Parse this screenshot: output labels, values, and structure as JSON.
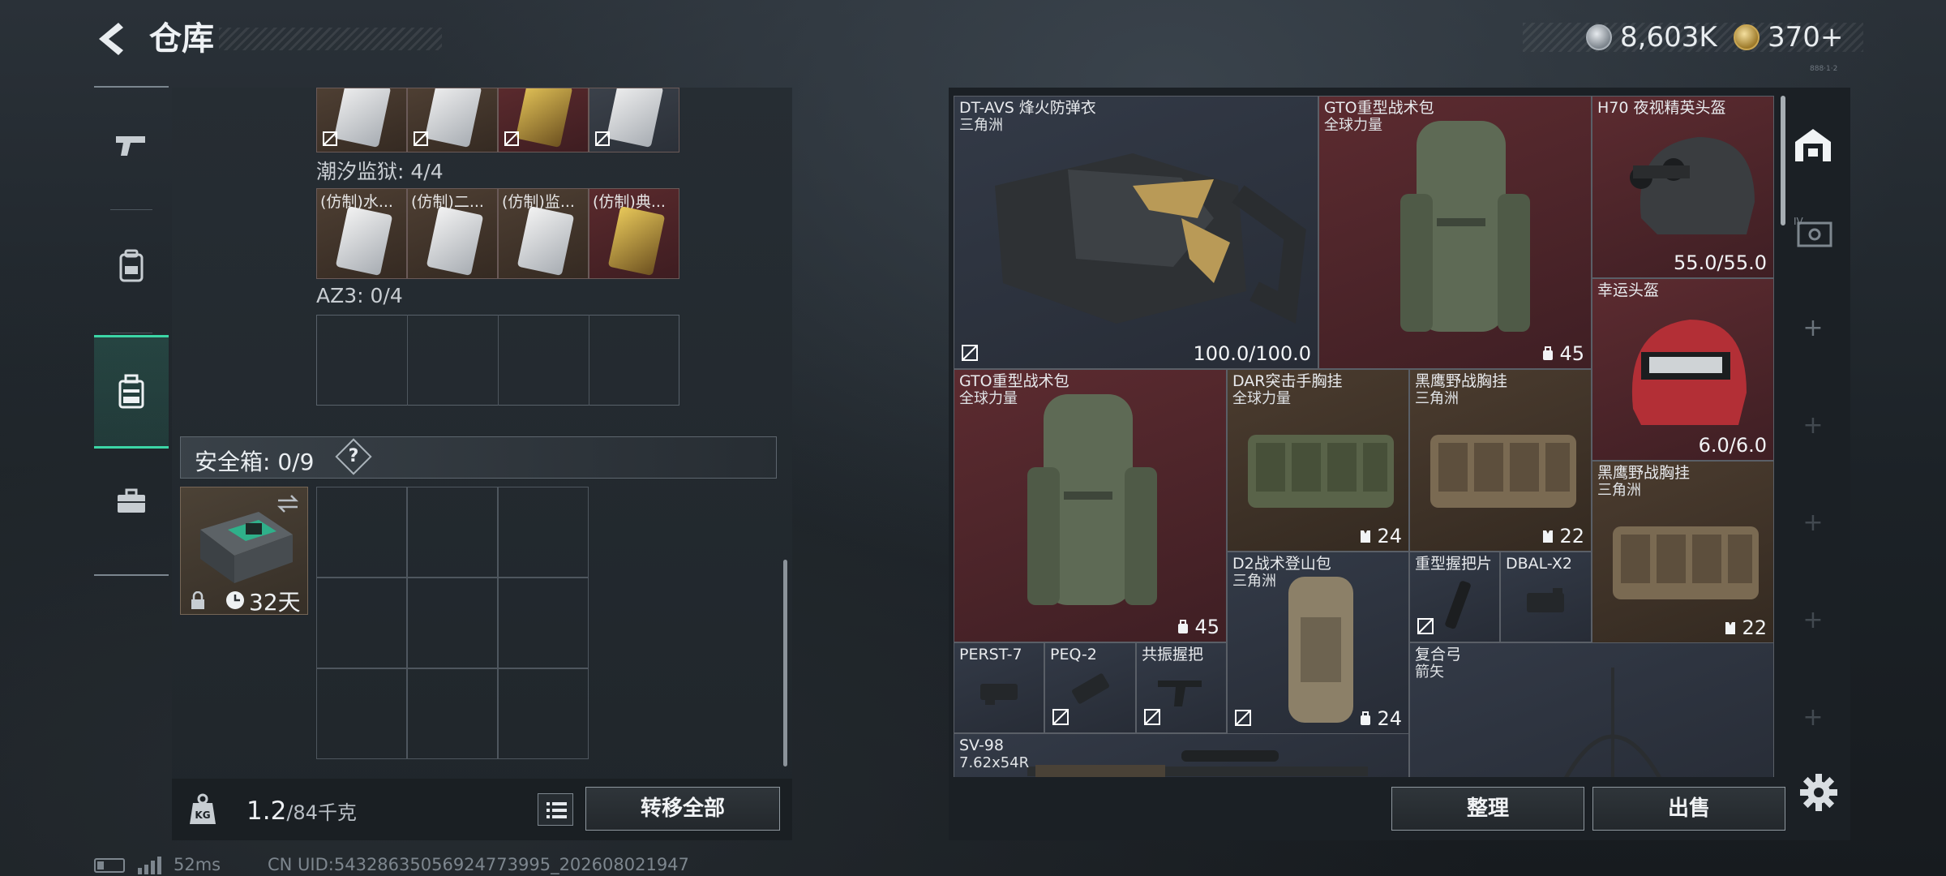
{
  "header": {
    "title": "仓库",
    "currency_silver": "8,603K",
    "currency_gold": "370+",
    "tiny_id": "888·1·2"
  },
  "left_nav": {
    "items": [
      {
        "icon": "pistol-icon"
      },
      {
        "icon": "backpack-icon"
      },
      {
        "icon": "storage-case-icon",
        "active": true
      },
      {
        "icon": "briefcase-icon"
      }
    ]
  },
  "containers": {
    "top_row_labels": [
      "",
      "",
      "",
      ""
    ],
    "section1": {
      "label": "潮汐监狱: 4/4",
      "tiles": [
        "(仿制)水...",
        "(仿制)二...",
        "(仿制)监...",
        "(仿制)典..."
      ]
    },
    "section2": {
      "label": "AZ3: 0/4"
    }
  },
  "safe": {
    "label": "安全箱: 0/9",
    "help": "?",
    "timer": "32天"
  },
  "weight": {
    "current": "1.2",
    "max": "/84千克"
  },
  "buttons": {
    "transfer_all": "转移全部",
    "sort": "整理",
    "sell": "出售"
  },
  "footer": {
    "ping": "52ms",
    "uid": "CN UID:54328635056924773995_202608021947"
  },
  "stash": {
    "items": [
      {
        "name": "DT-AVS 烽火防弹衣",
        "sub": "三角洲",
        "value": "100.0/100.0",
        "bg": "gray"
      },
      {
        "name": "GTO重型战术包",
        "sub": "全球力量",
        "value": "45",
        "bg": "red"
      },
      {
        "name": "H70 夜视精英头盔",
        "sub": "",
        "value": "55.0/55.0",
        "bg": "red"
      },
      {
        "name": "幸运头盔",
        "sub": "",
        "value": "6.0/6.0",
        "bg": "red"
      },
      {
        "name": "GTO重型战术包",
        "sub": "全球力量",
        "value": "45",
        "bg": "red"
      },
      {
        "name": "DAR突击手胸挂",
        "sub": "全球力量",
        "value": "24",
        "bg": "brown"
      },
      {
        "name": "黑鹰野战胸挂",
        "sub": "三角洲",
        "value": "22",
        "bg": "brown"
      },
      {
        "name": "黑鹰野战胸挂",
        "sub": "三角洲",
        "value": "22",
        "bg": "brown"
      },
      {
        "name": "D2战术登山包",
        "sub": "三角洲",
        "value": "24",
        "bg": "gray"
      },
      {
        "name": "重型握把片",
        "sub": "",
        "value": "",
        "bg": "gray"
      },
      {
        "name": "DBAL-X2",
        "sub": "",
        "value": "",
        "bg": "gray"
      },
      {
        "name": "PERST-7",
        "sub": "",
        "value": "",
        "bg": "gray"
      },
      {
        "name": "PEQ-2",
        "sub": "",
        "value": "",
        "bg": "gray"
      },
      {
        "name": "共振握把",
        "sub": "",
        "value": "",
        "bg": "gray"
      },
      {
        "name": "复合弓",
        "sub": "箭矢",
        "value": "",
        "bg": "gray"
      },
      {
        "name": "SV-98",
        "sub": "7.62x54R",
        "value": "",
        "bg": "gray"
      }
    ]
  },
  "colors": {
    "accent_active": "#3cd6a6",
    "rarity_red": "#5c2b30",
    "rarity_brown": "#4b3c2f",
    "rarity_gray": "#333a47"
  }
}
